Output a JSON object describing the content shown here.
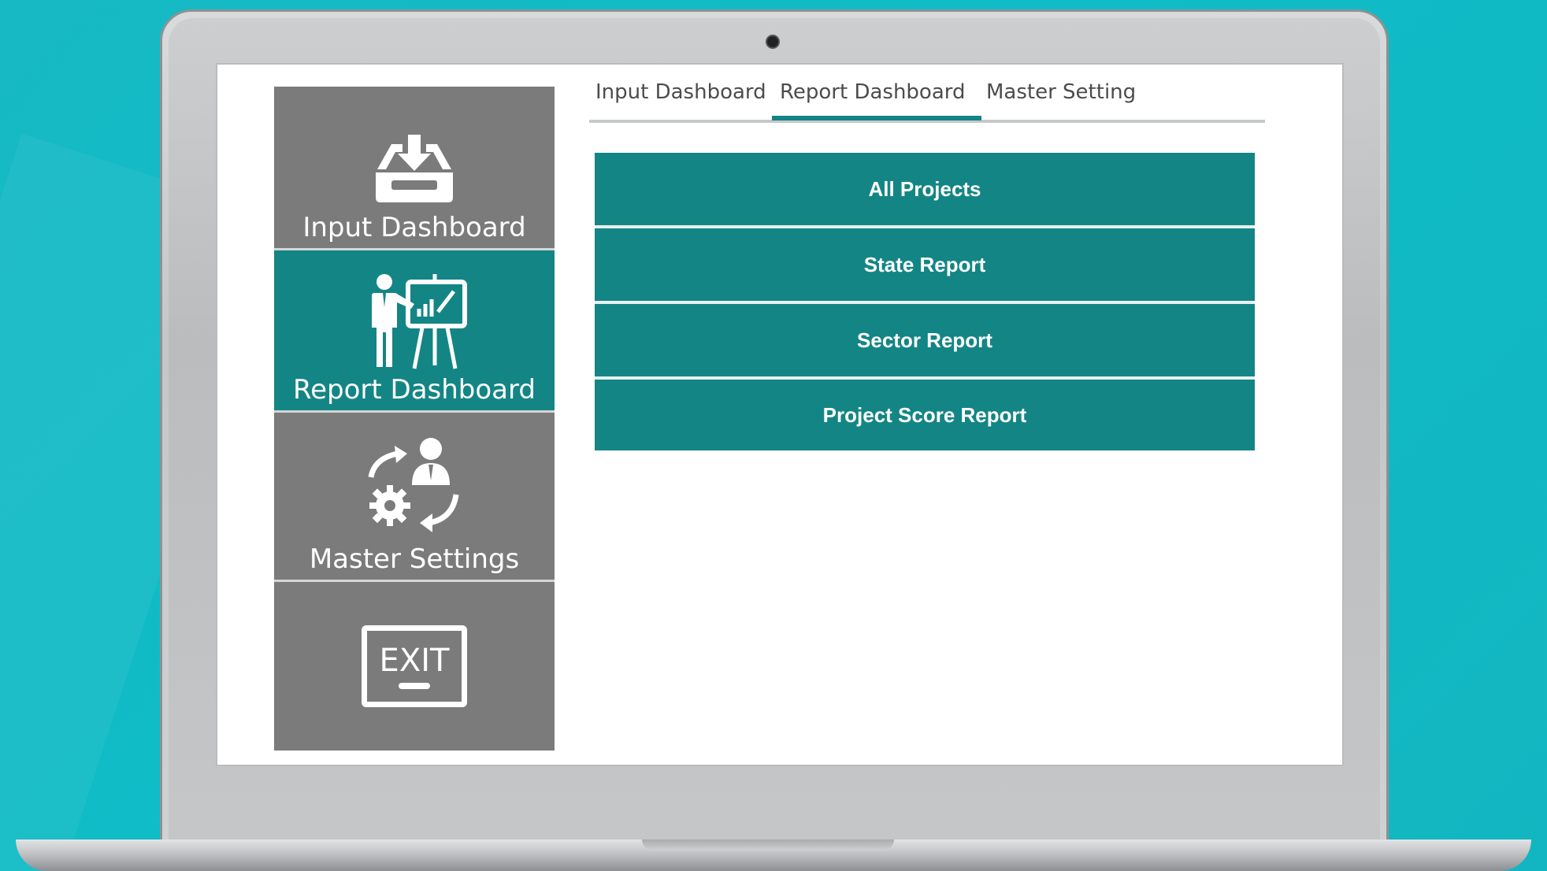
{
  "sidebar": {
    "items": [
      {
        "label": "Input Dashboard",
        "icon": "inbox-download-icon"
      },
      {
        "label": "Report Dashboard",
        "icon": "presenter-board-icon",
        "active": true
      },
      {
        "label": "Master Settings",
        "icon": "user-gear-cycle-icon"
      },
      {
        "label": "EXIT",
        "icon": "exit-sign-icon"
      }
    ]
  },
  "tabs": [
    {
      "label": "Input Dashboard"
    },
    {
      "label": "Report Dashboard",
      "active": true
    },
    {
      "label": "Master Setting"
    }
  ],
  "reports": [
    {
      "label": "All Projects"
    },
    {
      "label": "State Report"
    },
    {
      "label": "Sector Report"
    },
    {
      "label": "Project Score Report"
    }
  ],
  "colors": {
    "accent": "#148585",
    "sidebar": "#7b7b7b",
    "background": "#12b8c3"
  }
}
